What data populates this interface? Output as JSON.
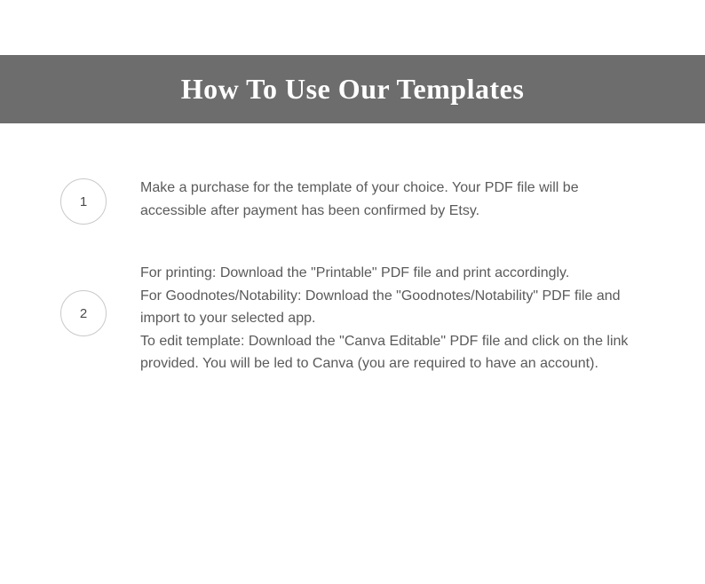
{
  "title": "How To Use Our Templates",
  "steps": [
    {
      "number": "1",
      "text": "Make a purchase for the template of your choice. Your PDF file will be accessible after payment has been confirmed by Etsy."
    },
    {
      "number": "2",
      "text": "For printing: Download the \"Printable\" PDF file and print accordingly.\nFor Goodnotes/Notability: Download the \"Goodnotes/Notability\" PDF file and import to your selected app.\nTo edit template: Download the \"Canva Editable\" PDF file and click on the link provided. You will be led to Canva (you are required to have an account)."
    }
  ]
}
